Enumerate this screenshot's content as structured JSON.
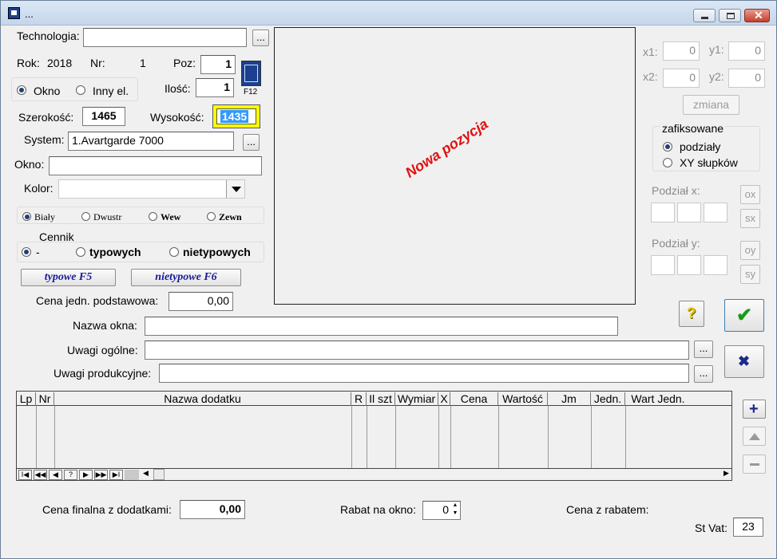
{
  "window": {
    "title": "...",
    "f12_label": "F12"
  },
  "form": {
    "technologia_label": "Technologia:",
    "technologia_value": "",
    "rok_label": "Rok:",
    "rok_value": "2018",
    "nr_label": "Nr:",
    "nr_value": "1",
    "poz_label": "Poz:",
    "poz_value": "1",
    "ilosc_label": "Ilość:",
    "ilosc_value": "1",
    "type_okno": "Okno",
    "type_inny": "Inny el.",
    "szerokosc_label": "Szerokość:",
    "szerokosc_value": "1465",
    "wysokosc_label": "Wysokość:",
    "wysokosc_value": "1435",
    "system_label": "System:",
    "system_value": "1.Avartgarde 7000",
    "okno_label": "Okno:",
    "okno_value": "",
    "kolor_label": "Kolor:",
    "kolor_value": "",
    "color_options": [
      "Biały",
      "Dwustr",
      "Wew",
      "Zewn"
    ],
    "cennik_label": "Cennik",
    "cennik_options": [
      "-",
      "typowych",
      "nietypowych"
    ],
    "typowe_btn": "typowe F5",
    "nietypowe_btn": "nietypowe F6",
    "cena_jedn_label": "Cena jedn. podstawowa:",
    "cena_jedn_value": "0,00",
    "nazwa_okna_label": "Nazwa okna:",
    "nazwa_okna_value": "",
    "uwagi_ogolne_label": "Uwagi ogólne:",
    "uwagi_ogolne_value": "",
    "uwagi_prod_label": "Uwagi produkcyjne:",
    "uwagi_prod_value": "",
    "ellipsis": "..."
  },
  "preview": {
    "text": "Nowa pozycja",
    "text_color": "#e01010"
  },
  "coords": {
    "x1_label": "x1:",
    "x1_value": "0",
    "y1_label": "y1:",
    "y1_value": "0",
    "x2_label": "x2:",
    "x2_value": "0",
    "y2_label": "y2:",
    "y2_value": "0",
    "zmiana_btn": "zmiana",
    "zafiksowane_label": "zafiksowane",
    "podzialy_label": "podziały",
    "xy_label": "XY słupków",
    "podzial_x_label": "Podział x:",
    "podzial_y_label": "Podział y:",
    "ox": "ox",
    "sx": "sx",
    "oy": "oy",
    "sy": "sy"
  },
  "grid": {
    "columns": [
      "Lp",
      "Nr",
      "Nazwa dodatku",
      "R",
      "Il szt",
      "Wymiar",
      "X",
      "Cena",
      "Wartość",
      "Jm",
      "Jedn.",
      "Wart Jedn."
    ],
    "nav": [
      "I◀",
      "◀◀",
      "◀",
      "?",
      "▶",
      "▶▶",
      "▶I"
    ]
  },
  "footer": {
    "cena_final_label": "Cena finalna z dodatkami:",
    "cena_final_value": "0,00",
    "rabat_label": "Rabat na okno:",
    "rabat_value": "0",
    "cena_rabat_label": "Cena z rabatem:",
    "stvat_label": "St Vat:",
    "stvat_value": "23"
  }
}
